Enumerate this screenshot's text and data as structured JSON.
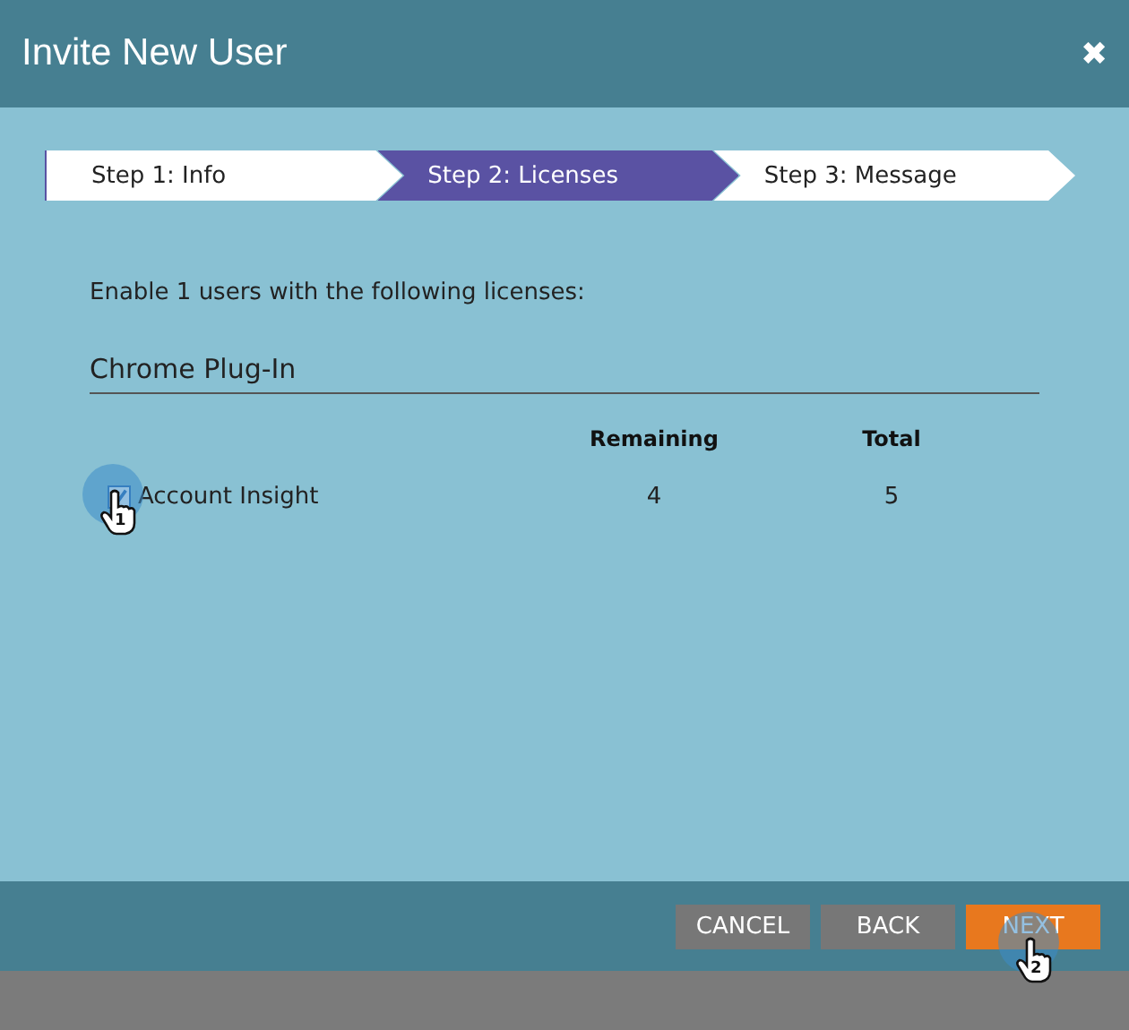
{
  "window": {
    "title": "Invite New User",
    "close": "✖"
  },
  "steps": [
    {
      "label": "Step 1: Info",
      "selected": false
    },
    {
      "label": "Step 2: Licenses",
      "selected": true
    },
    {
      "label": "Step 3: Message",
      "selected": false
    }
  ],
  "intro": "Enable 1 users with the following licenses:",
  "section": "Chrome Plug-In",
  "columns": [
    "Remaining",
    "Total"
  ],
  "licenses": [
    {
      "name": "Account Insight",
      "checked": true,
      "remaining": "4",
      "total": "5",
      "callout": "1"
    }
  ],
  "buttons": [
    {
      "label": "CANCEL",
      "kind": "secondary"
    },
    {
      "label": "BACK",
      "kind": "secondary"
    },
    {
      "label": "NEXT",
      "kind": "primary",
      "callout": "2"
    }
  ]
}
